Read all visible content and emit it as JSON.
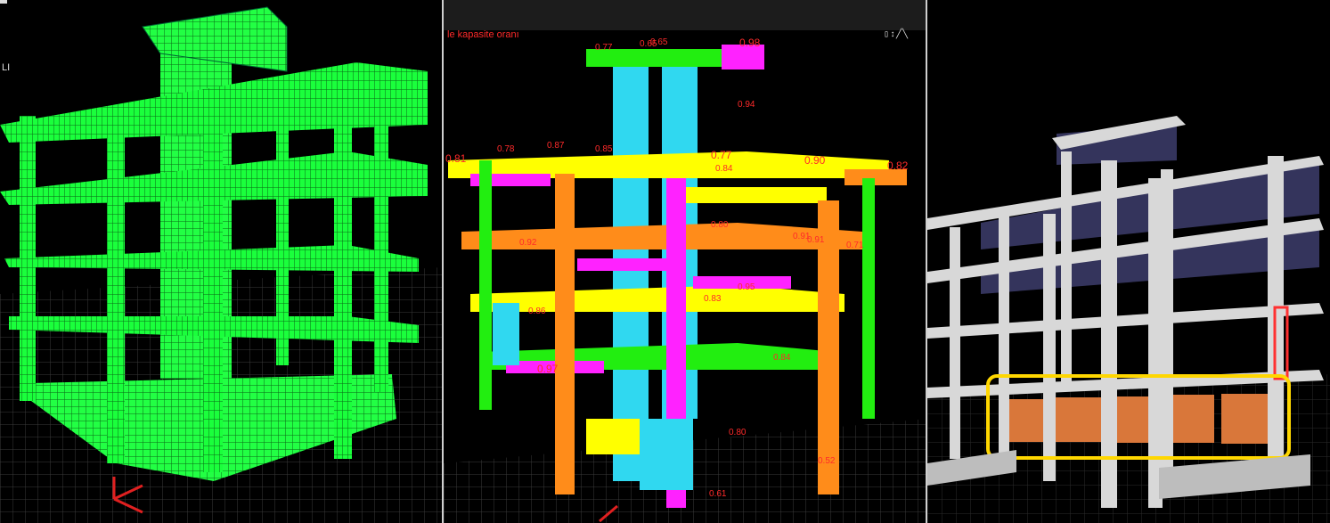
{
  "left_panel": {
    "corner_label": "LI",
    "structure_color": "#1aff3c"
  },
  "middle_panel": {
    "mode_label": "le kapasite oranı",
    "corner_label": "▯↕╱╲",
    "legend_colors": {
      "green": "#22ee10",
      "yellow": "#ffff00",
      "orange": "#ff8c1a",
      "magenta": "#ff22ff",
      "cyan": "#30d8f0"
    },
    "ratio_labels": [
      "0.77",
      "0.65",
      "0.65",
      "0.98",
      "0.78",
      "0.87",
      "0.85",
      "0.81",
      "0.77",
      "0.90",
      "0.82",
      "0.84",
      "0.94",
      "0.80",
      "0.91",
      "0.71",
      "0.92",
      "0.95",
      "0.86",
      "0.97",
      "0.80",
      "0.84",
      "0.91",
      "0.61",
      "0.83",
      "0.52"
    ]
  },
  "right_panel": {
    "structure_color": "#d8d8d8",
    "slab_color": "#3a3a66",
    "infill_color": "#d9773a",
    "highlight_color": "#ffd700",
    "alert_color": "#ff3030"
  }
}
